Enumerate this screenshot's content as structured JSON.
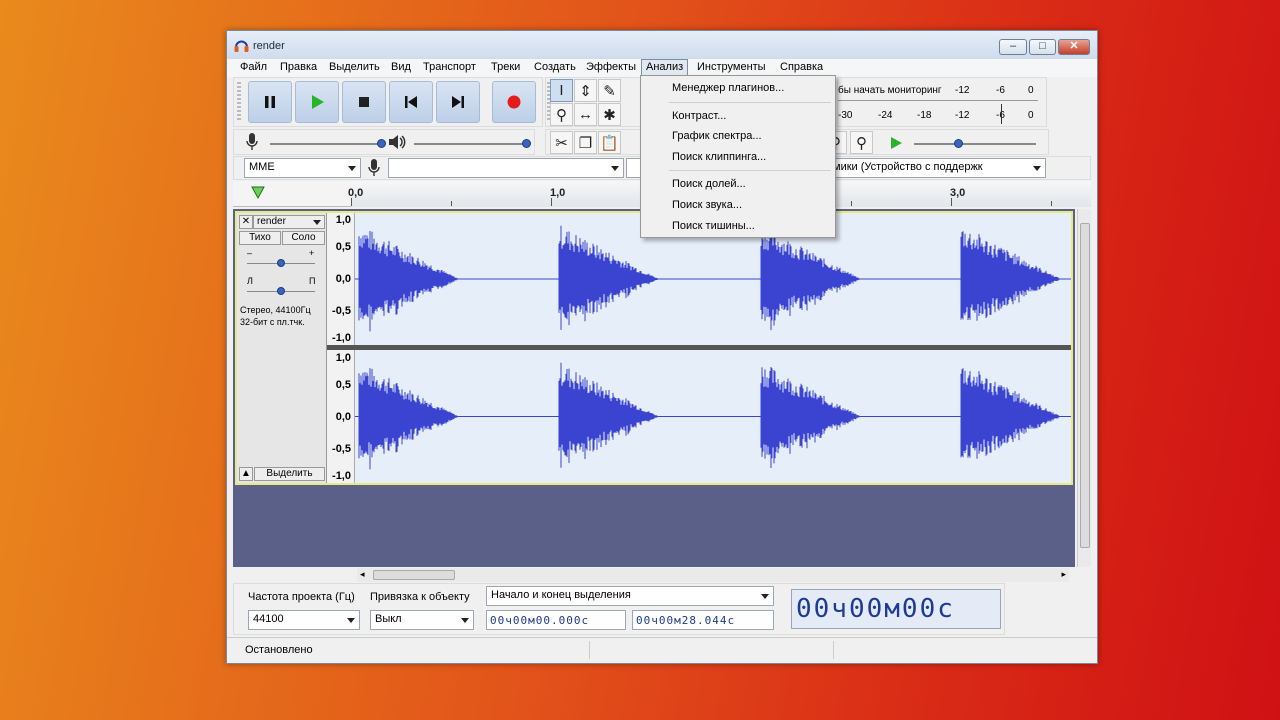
{
  "window": {
    "title": "render",
    "minimize": "–",
    "maximize": "□",
    "close": "✕"
  },
  "menu": [
    "Файл",
    "Правка",
    "Выделить",
    "Вид",
    "Транспорт",
    "Треки",
    "Создать",
    "Эффекты",
    "Анализ",
    "Инструменты",
    "Справка"
  ],
  "analysis_menu": {
    "items": [
      "Менеджер плагинов...",
      "Контраст...",
      "График спектра...",
      "Поиск клиппинга...",
      "Поиск долей...",
      "Поиск звука...",
      "Поиск тишины..."
    ]
  },
  "meter": {
    "label": "бы начать мониторинг",
    "ticks_top": [
      "-12",
      "-6",
      "0"
    ],
    "ticks_bottom": [
      "-30",
      "-24",
      "-18",
      "-12",
      "-6",
      "0"
    ]
  },
  "device": {
    "host": "MME",
    "output": "мики (Устройство с поддержк"
  },
  "ruler": {
    "labels": [
      "0,0",
      "1,0",
      "3,0"
    ]
  },
  "track": {
    "name": "render",
    "mute": "Тихо",
    "solo": "Соло",
    "gain_minus": "–",
    "gain_plus": "+",
    "pan_left": "Л",
    "pan_right": "П",
    "info_line1": "Стерео, 44100Гц",
    "info_line2": "32-бит с пл.тчк.",
    "select": "Выделить",
    "scale": [
      "1,0",
      "0,5",
      "0,0",
      "-0,5",
      "-1,0"
    ]
  },
  "selection_bar": {
    "rate_label": "Частота проекта (Гц)",
    "rate_value": "44100",
    "snap_label": "Привязка к объекту",
    "snap_value": "Выкл",
    "mode_value": "Начало и конец выделения",
    "start_time": "00ч00м00.000с",
    "end_time": "00ч00м28.044с",
    "big_time": "00ч00м00с"
  },
  "status": {
    "text": "Остановлено"
  },
  "colors": {
    "waveform": "#3b44d0",
    "track_border": "#e9e982",
    "track_bg": "#5b6089"
  }
}
